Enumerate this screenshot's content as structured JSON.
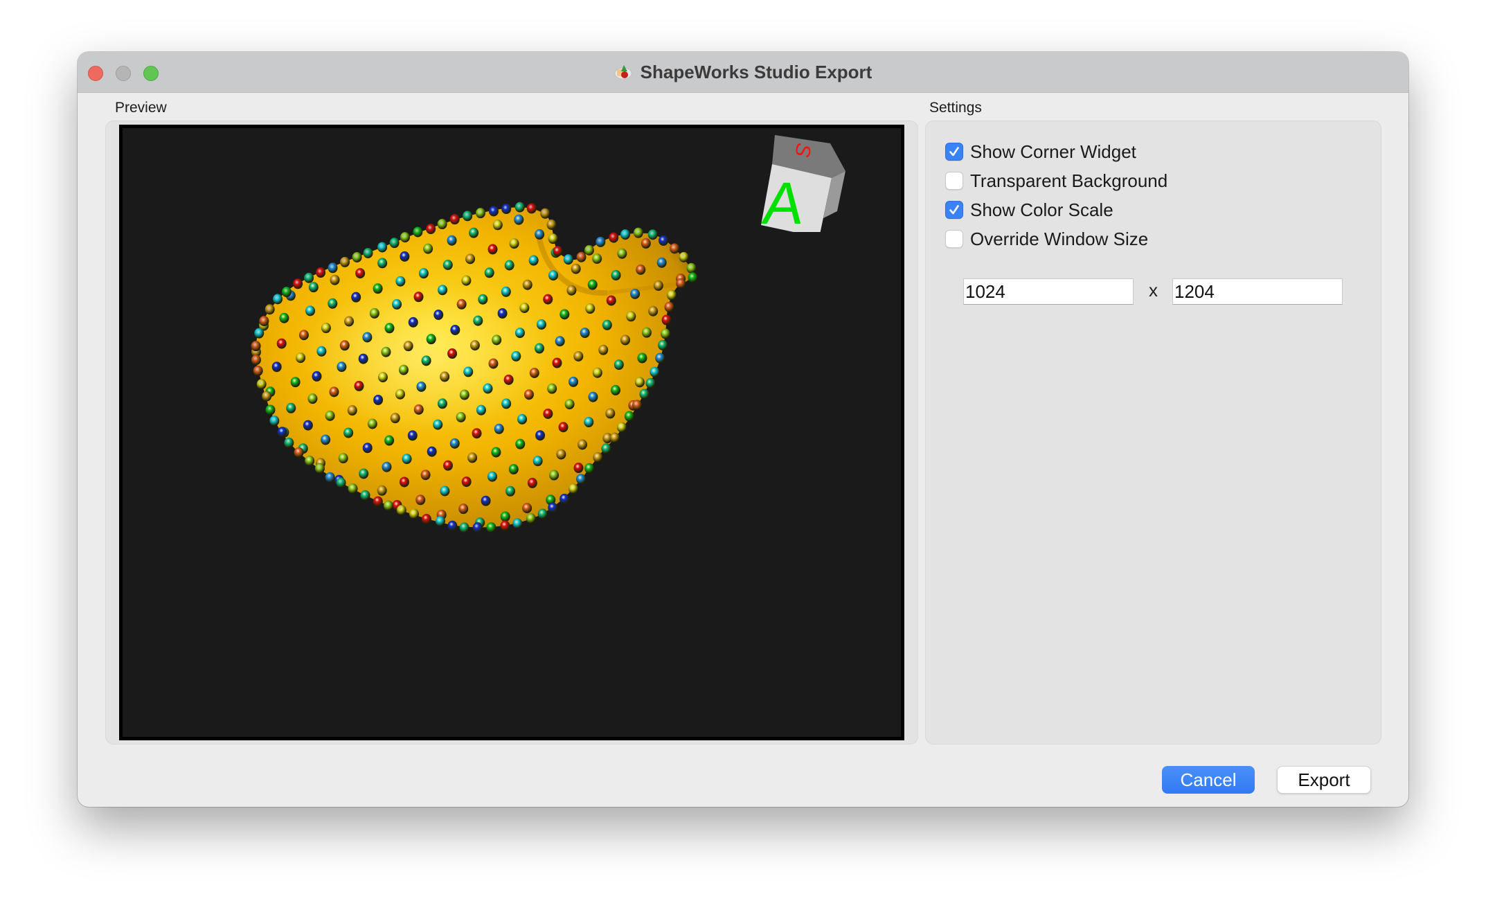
{
  "window": {
    "title": "ShapeWorks Studio Export",
    "app_icon": "shapeworks-app-icon"
  },
  "preview": {
    "label": "Preview",
    "corner_widget": {
      "front_letter": "A",
      "top_letter": "S",
      "front_letter_color": "#00e000",
      "top_letter_color": "#ff1010"
    },
    "surface_color": "#f0b400",
    "background_color": "#1a1a1a"
  },
  "settings": {
    "label": "Settings",
    "options": [
      {
        "label": "Show Corner Widget",
        "checked": true
      },
      {
        "label": "Transparent Background",
        "checked": false
      },
      {
        "label": "Show Color Scale",
        "checked": true
      },
      {
        "label": "Override Window Size",
        "checked": false
      }
    ],
    "width_value": "1024",
    "height_value": "1204",
    "separator": "x"
  },
  "buttons": {
    "cancel": "Cancel",
    "export": "Export"
  },
  "colors": {
    "accent": "#3a82f7",
    "particle_palette": [
      "#e01010",
      "#e06020",
      "#d0a020",
      "#d8d820",
      "#90d020",
      "#10c020",
      "#10c080",
      "#10d0e0",
      "#2090e0",
      "#1030d0"
    ]
  }
}
